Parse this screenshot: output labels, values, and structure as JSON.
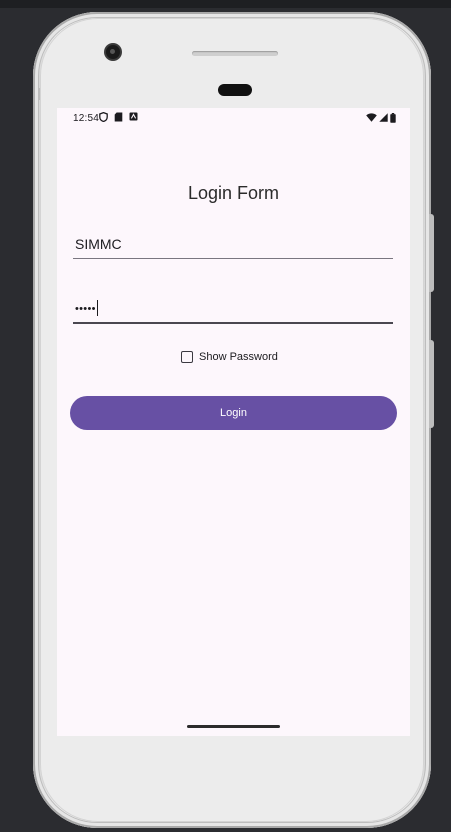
{
  "status_bar": {
    "time": "12:54",
    "left_icons": [
      "vpn-shield-icon",
      "sd-card-icon",
      "notification-app-icon"
    ],
    "right_icons": [
      "wifi-icon",
      "cell-signal-icon",
      "battery-icon"
    ]
  },
  "form": {
    "title": "Login Form",
    "username_value": "SIMMC",
    "password_value": "•••••",
    "show_password_label": "Show Password",
    "show_password_checked": false,
    "login_label": "Login"
  },
  "colors": {
    "screen_background": "#fdf7fc",
    "accent": "#6750a4",
    "button_text": "#ffffff",
    "text": "#1c1b1f",
    "device_background": "#2b2c30"
  }
}
